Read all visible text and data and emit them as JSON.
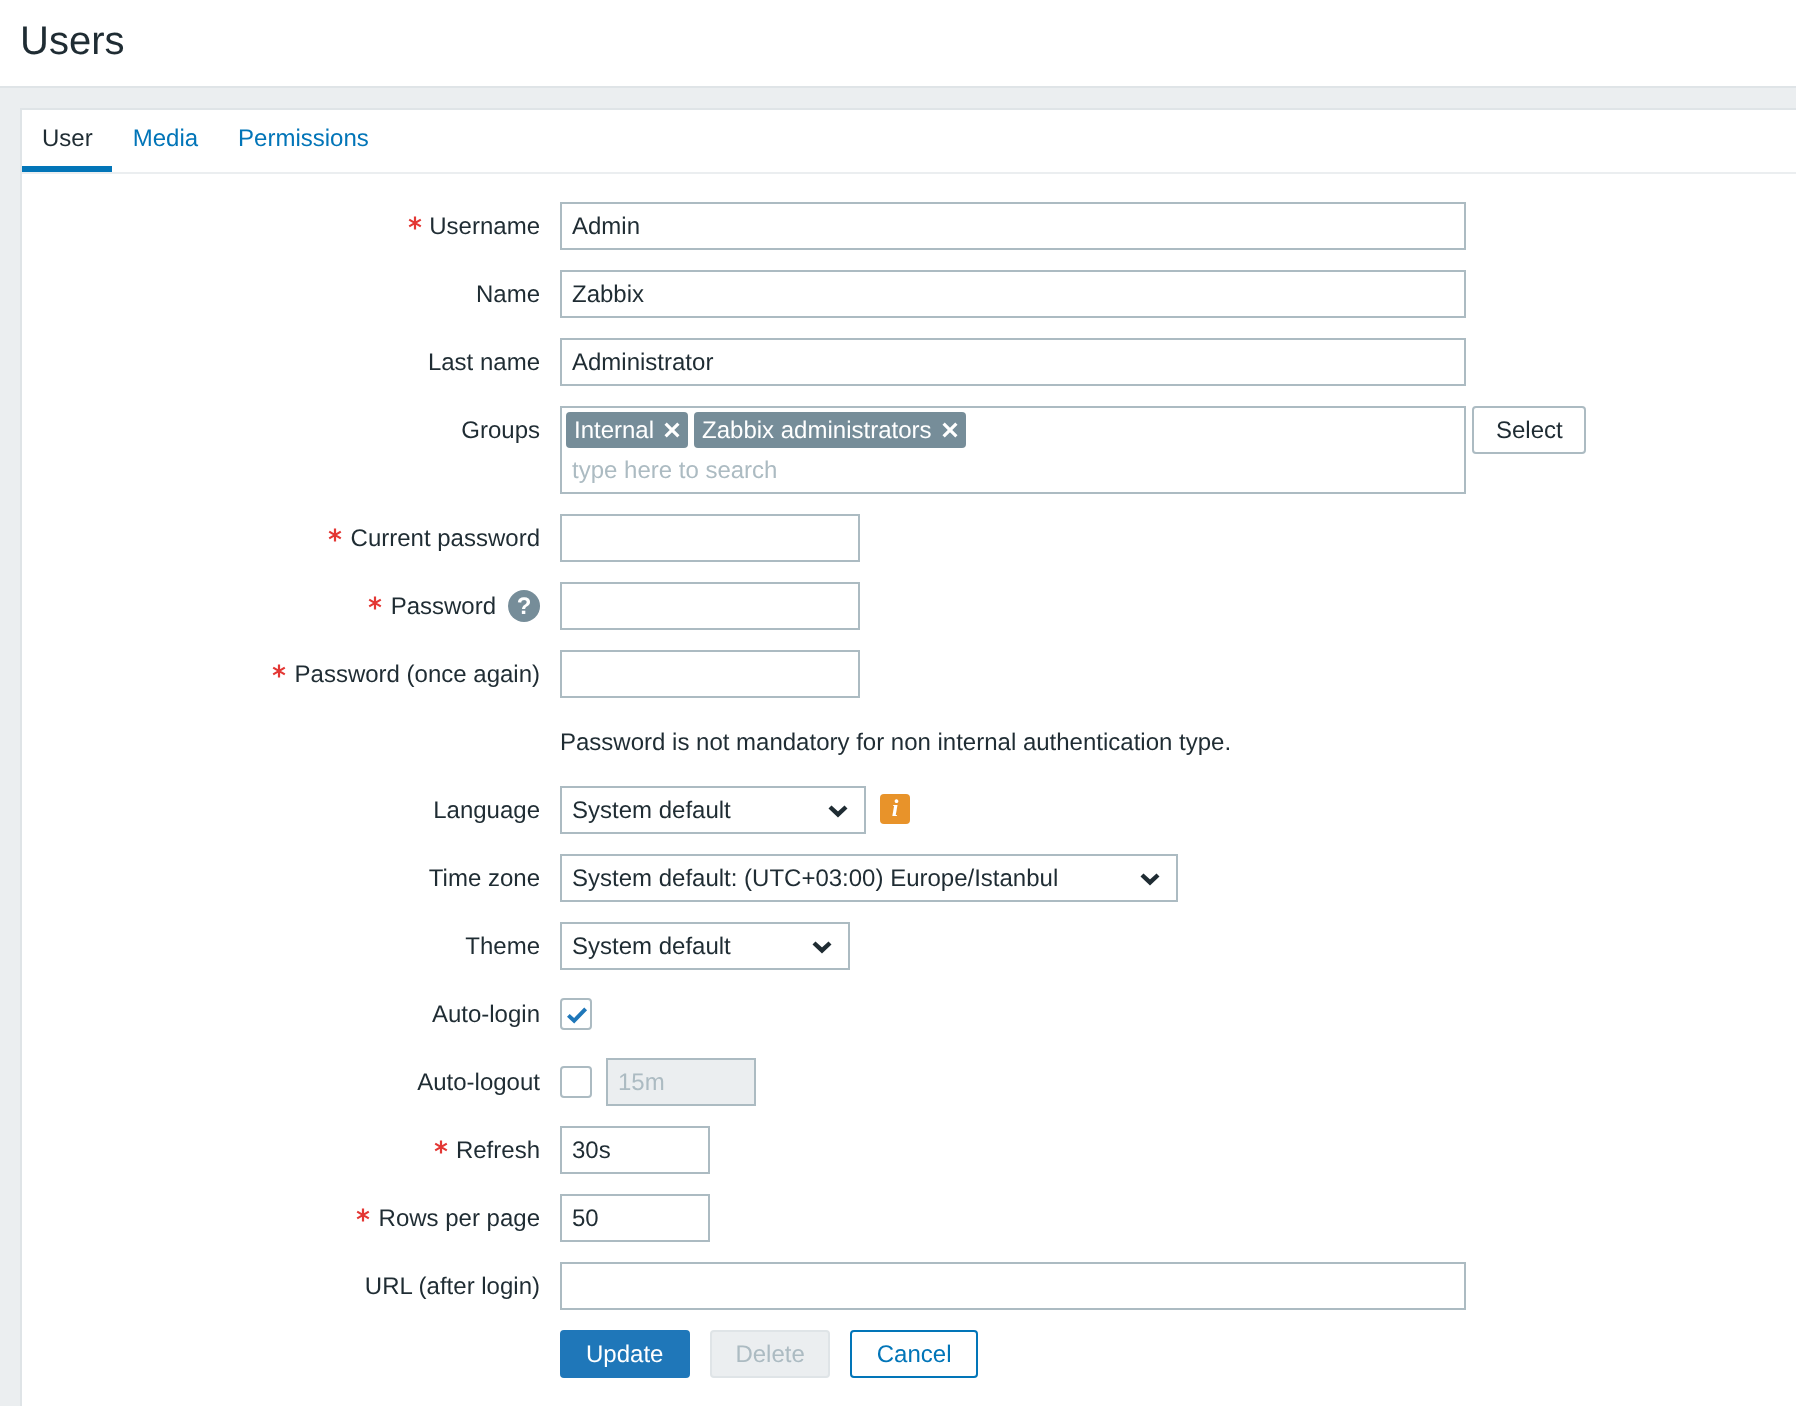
{
  "page": {
    "title": "Users"
  },
  "tabs": [
    {
      "label": "User",
      "selected": true
    },
    {
      "label": "Media",
      "selected": false
    },
    {
      "label": "Permissions",
      "selected": false
    }
  ],
  "form": {
    "rows": [
      {
        "kind": "text",
        "label": "Username",
        "required": true,
        "value": "Admin"
      },
      {
        "kind": "text",
        "label": "Name",
        "required": false,
        "value": "Zabbix"
      },
      {
        "kind": "text",
        "label": "Last name",
        "required": false,
        "value": "Administrator"
      },
      {
        "kind": "multiselect",
        "label": "Groups",
        "required": false,
        "tags": [
          {
            "label": "Internal"
          },
          {
            "label": "Zabbix administrators"
          }
        ],
        "placeholder": "type here to search",
        "button": "Select"
      },
      {
        "kind": "password",
        "label": "Current password",
        "required": true
      },
      {
        "kind": "password",
        "label": "Password",
        "required": true,
        "help": "?"
      },
      {
        "kind": "password",
        "label": "Password (once again)",
        "required": true
      },
      {
        "kind": "note",
        "text": "Password is not mandatory for non internal authentication type."
      },
      {
        "kind": "select",
        "label": "Language",
        "required": false,
        "value": "System default",
        "info": "i"
      },
      {
        "kind": "select",
        "label": "Time zone",
        "required": false,
        "value": "System default: (UTC+03:00) Europe/Istanbul"
      },
      {
        "kind": "select",
        "label": "Theme",
        "required": false,
        "value": "System default"
      },
      {
        "kind": "checkbox",
        "label": "Auto-login",
        "required": false,
        "checked": true
      },
      {
        "kind": "checkbox_input",
        "label": "Auto-logout",
        "required": false,
        "checked": false,
        "value": "15m",
        "input_disabled": true
      },
      {
        "kind": "text",
        "label": "Refresh",
        "required": true,
        "value": "30s"
      },
      {
        "kind": "text",
        "label": "Rows per page",
        "required": true,
        "value": "50"
      },
      {
        "kind": "text",
        "label": "URL (after login)",
        "required": false
      }
    ],
    "buttons": [
      {
        "label": "Update",
        "kind": "primary",
        "disabled": false
      },
      {
        "label": "Delete",
        "kind": "secondary",
        "disabled": true
      },
      {
        "label": "Cancel",
        "kind": "secondary",
        "disabled": false
      }
    ]
  }
}
